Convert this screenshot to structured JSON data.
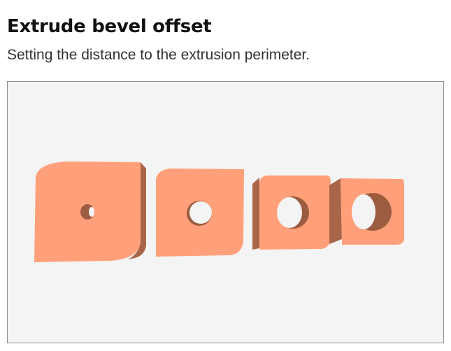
{
  "header": {
    "title": "Extrude bevel offset",
    "subtitle": "Setting the distance to the extrusion perimeter."
  },
  "viewport": {
    "background_color": "#f4f4f4",
    "shape_front_color": "#ffa07a",
    "shape_side_color": "#a86548",
    "shape_hole_inner_color": "#9c5c40",
    "shape_count": 4
  }
}
